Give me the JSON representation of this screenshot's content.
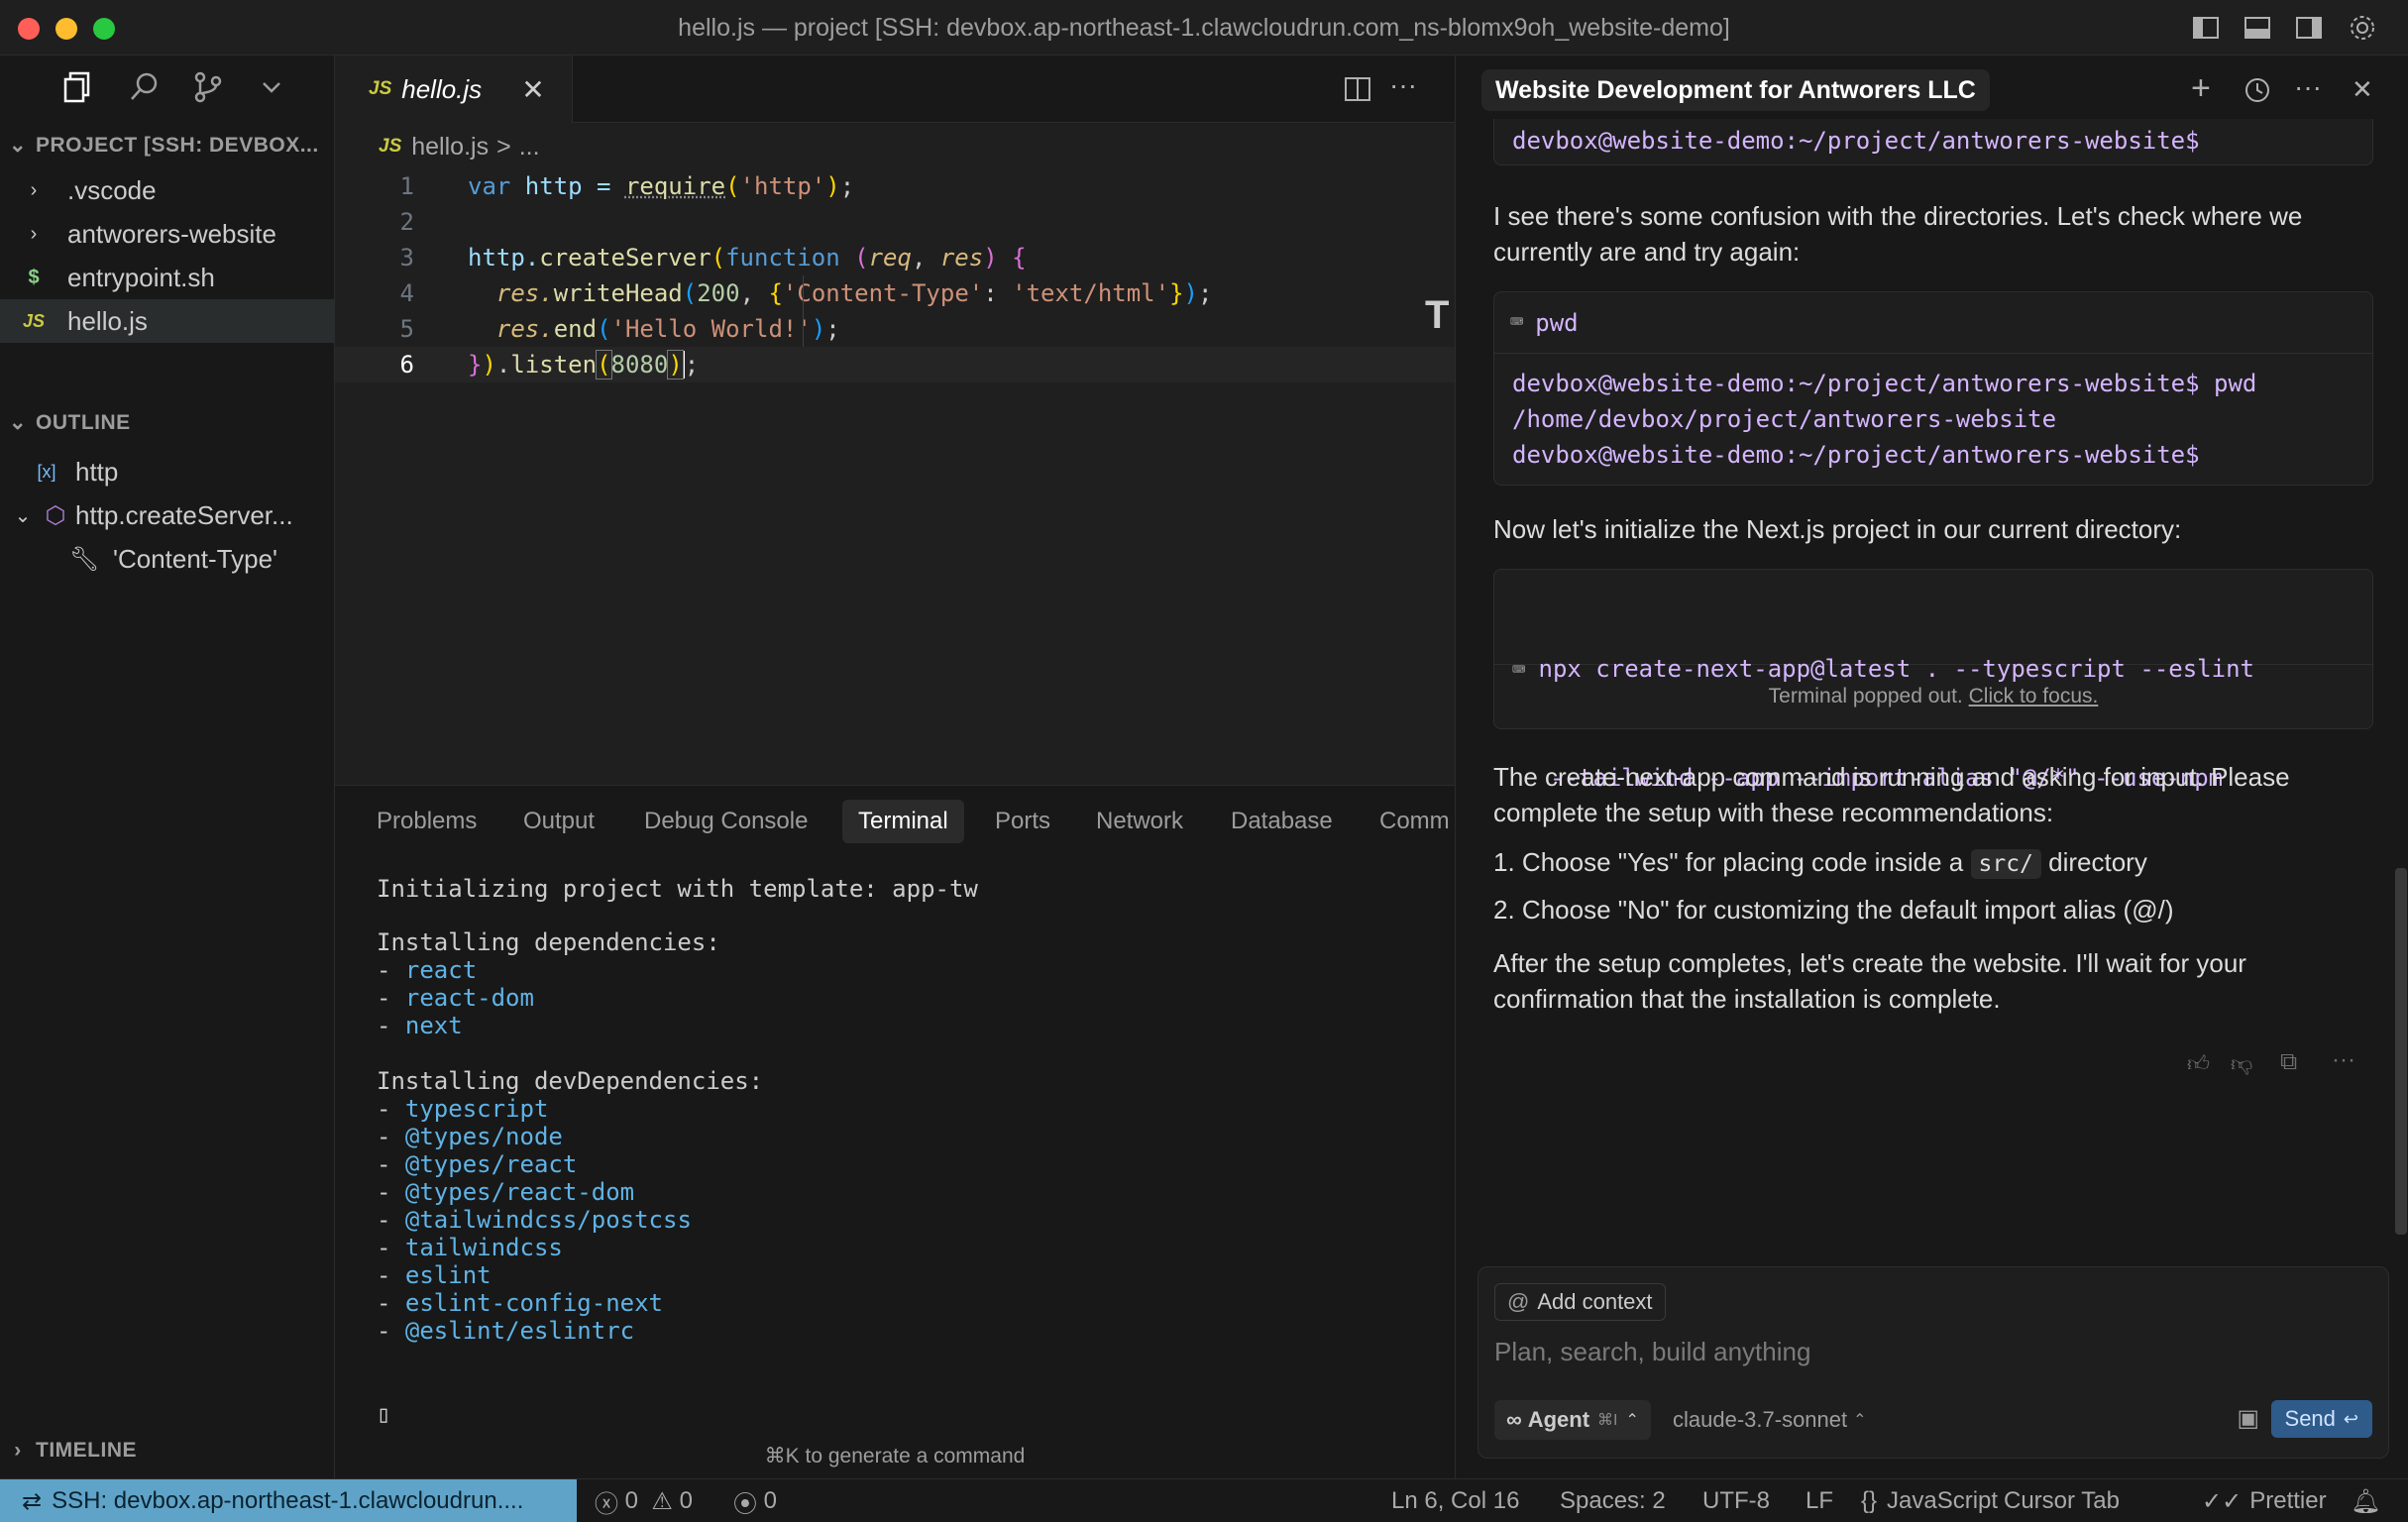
{
  "window": {
    "title": "hello.js — project [SSH: devbox.ap-northeast-1.clawcloudrun.com_ns-blomx9oh_website-demo]"
  },
  "explorer": {
    "project_header": "PROJECT [SSH: DEVBOX...",
    "items": [
      {
        "label": ".vscode",
        "icon": "chevron-right-icon"
      },
      {
        "label": "antworers-website",
        "icon": "chevron-right-icon"
      },
      {
        "label": "entrypoint.sh",
        "icon": "dollar-icon"
      },
      {
        "label": "hello.js",
        "icon": "js-icon"
      }
    ],
    "outline_header": "OUTLINE",
    "outline_items": [
      {
        "label": "http",
        "icon": "variable-icon"
      },
      {
        "label": "http.createServer...",
        "icon": "cube-icon"
      },
      {
        "label": "'Content-Type'",
        "icon": "wrench-icon"
      }
    ],
    "timeline_header": "TIMELINE"
  },
  "editor": {
    "tab_badge": "JS",
    "tab_label": "hello.js",
    "breadcrumb_badge": "JS",
    "breadcrumb_file": "hello.js",
    "breadcrumb_sep": ">",
    "breadcrumb_rest": "...",
    "line_numbers": [
      "1",
      "2",
      "3",
      "4",
      "5",
      "6"
    ],
    "code": {
      "l1_var": "var",
      "l1_name": " http = ",
      "l1_fn": "require",
      "l1_arg": "'http'",
      "l1_end": ";",
      "l3_obj": "http.",
      "l3_fn": "createServer",
      "l3_kw": "function",
      "l3_p1": "req",
      "l3_p2": "res",
      "l4_obj": "res.",
      "l4_fn": "writeHead",
      "l4_num": "200",
      "l4_key": "'Content-Type'",
      "l4_val": "'text/html'",
      "l5_obj": "res.",
      "l5_fn": "end",
      "l5_str": "'Hello World!'",
      "l6_fn": "listen",
      "l6_num": "8080"
    }
  },
  "panel": {
    "tabs": [
      "Problems",
      "Output",
      "Debug Console",
      "Terminal",
      "Ports",
      "Network",
      "Database",
      "Comm"
    ],
    "active_tab": "Terminal",
    "terminal": {
      "line_init": "Initializing project with template: app-tw",
      "deps_header": "Installing dependencies:",
      "deps": [
        "react",
        "react-dom",
        "next"
      ],
      "devdeps_header": "Installing devDependencies:",
      "devdeps": [
        "typescript",
        "@types/node",
        "@types/react",
        "@types/react-dom",
        "@tailwindcss/postcss",
        "tailwindcss",
        "eslint",
        "eslint-config-next",
        "@eslint/eslintrc"
      ],
      "cursor": "▯"
    },
    "hint": "⌘K to generate a command"
  },
  "chat": {
    "title": "Website Development for Antworers LLC",
    "prompt_top": "devbox@website-demo:~/project/antworers-website$",
    "para1": "I see there's some confusion with the directories. Let's check where we currently are and try again:",
    "cmd1": "pwd",
    "cmd1_output": [
      "devbox@website-demo:~/project/antworers-website$ pwd",
      "/home/devbox/project/antworers-website",
      "devbox@website-demo:~/project/antworers-website$"
    ],
    "para2": "Now let's initialize the Next.js project in our current directory:",
    "cmd2_line1": "npx create-next-app@latest . --typescript --eslint",
    "cmd2_line2": "--tailwind --app --import-alias \"@/*\" --use-npm",
    "popped_text": "Terminal popped out.",
    "popped_link": "Click to focus.",
    "para3": "The create-next-app command is running and asking for input. Please complete the setup with these recommendations:",
    "list1_num": "1.",
    "list1_pre": "Choose \"Yes\" for placing code inside a",
    "list1_code": "src/",
    "list1_post": "directory",
    "list2_num": "2.",
    "list2": "Choose \"No\" for customizing the default import alias (@/)",
    "para4": "After the setup completes, let's create the website. I'll wait for your confirmation that the installation is complete.",
    "input": {
      "add_context": "Add context",
      "placeholder": "Plan, search, build anything",
      "agent_label": "Agent",
      "agent_shortcut": "⌘I",
      "model": "claude-3.7-sonnet",
      "send": "Send"
    }
  },
  "statusbar": {
    "remote": "SSH: devbox.ap-northeast-1.clawcloudrun....",
    "errors": "0",
    "warnings": "0",
    "ports": "0",
    "position": "Ln 6, Col 16",
    "spaces": "Spaces: 2",
    "encoding": "UTF-8",
    "eol": "LF",
    "language": "JavaScript",
    "cursor_tab": "Cursor Tab",
    "prettier": "Prettier"
  },
  "colors": {
    "accent_remote": "#5fa4c8",
    "close_dot": "#ff5f57",
    "min_dot": "#febc2e",
    "max_dot": "#28c840"
  }
}
